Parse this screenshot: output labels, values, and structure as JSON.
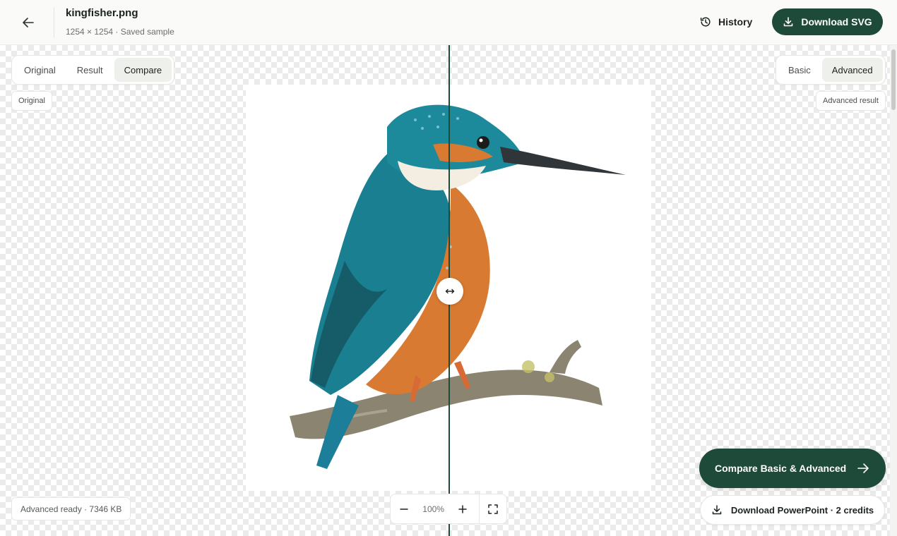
{
  "header": {
    "back_icon": "arrow-left-icon",
    "file_name": "kingfisher.png",
    "file_meta": "1254 × 1254 · Saved sample",
    "history_label": "History",
    "history_icon": "history-icon",
    "download_svg_label": "Download SVG",
    "download_icon": "download-icon"
  },
  "view_tabs": {
    "options": [
      "Original",
      "Result",
      "Compare"
    ],
    "selected": "Compare"
  },
  "mode_tabs": {
    "options": [
      "Basic",
      "Advanced"
    ],
    "selected": "Advanced"
  },
  "compare": {
    "left_label": "Original",
    "right_label": "Advanced result",
    "handle_icon": "left-right-arrow-icon"
  },
  "status": {
    "text": "Advanced ready · 7346 KB"
  },
  "zoom": {
    "level": "100%",
    "minus_icon": "minus-icon",
    "plus_icon": "plus-icon",
    "fit_icon": "fullscreen-icon"
  },
  "actions": {
    "compare_label": "Compare Basic & Advanced",
    "compare_icon": "arrow-right-icon",
    "ppt_label": "Download PowerPoint · 2 credits",
    "ppt_icon": "download-icon"
  },
  "colors": {
    "accent": "#1e4a3a",
    "bird_teal": "#1c8a9a",
    "bird_orange": "#d9782e"
  }
}
